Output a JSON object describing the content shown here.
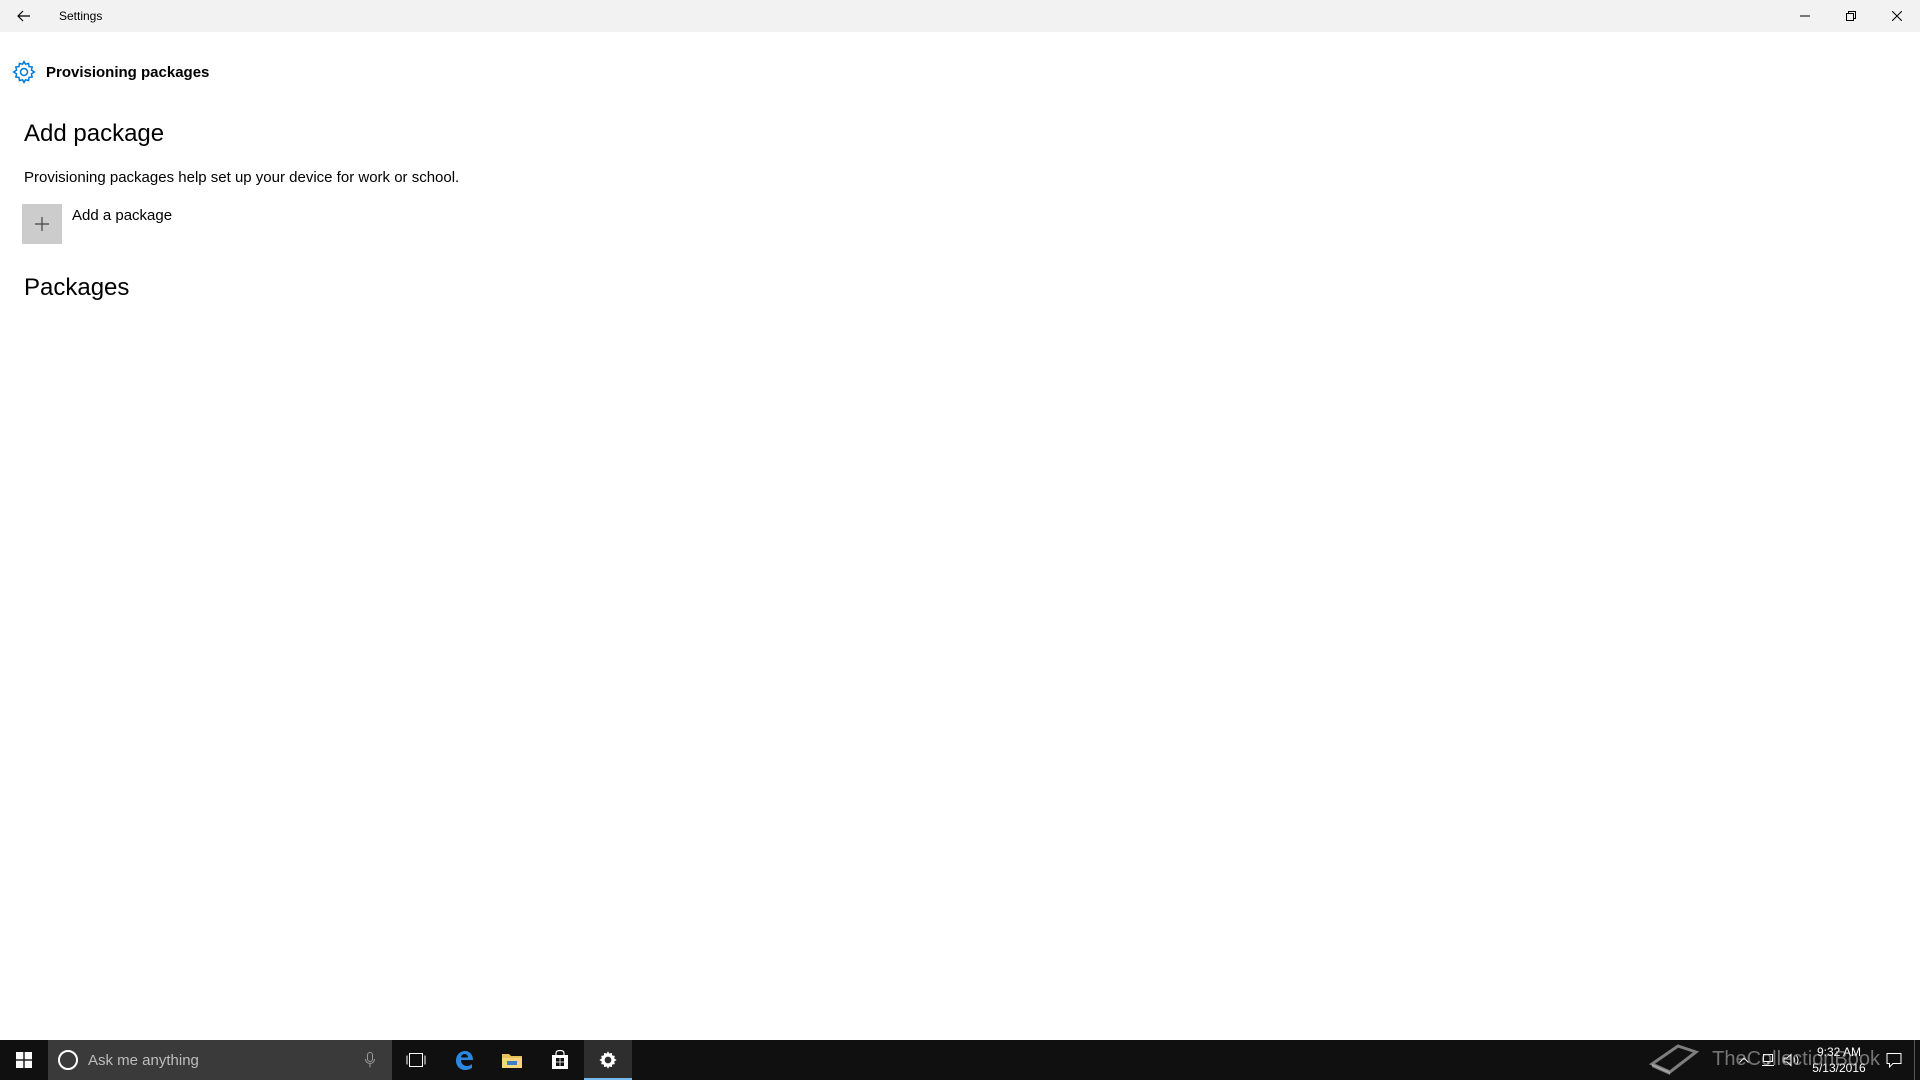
{
  "window": {
    "title": "Settings"
  },
  "page": {
    "title": "Provisioning packages"
  },
  "add_section": {
    "heading": "Add package",
    "description": "Provisioning packages help set up your device for work or school.",
    "add_button_label": "Add a package"
  },
  "packages_section": {
    "heading": "Packages"
  },
  "taskbar": {
    "search_placeholder": "Ask me anything",
    "watermark": "TheCollectionBook",
    "clock_time": "9:32 AM",
    "clock_date": "5/13/2016"
  },
  "colors": {
    "accent": "#0078d7",
    "taskbar_bg": "#101010",
    "titlebar_bg": "#f2f2f2",
    "tile_bg": "#cccccc"
  }
}
